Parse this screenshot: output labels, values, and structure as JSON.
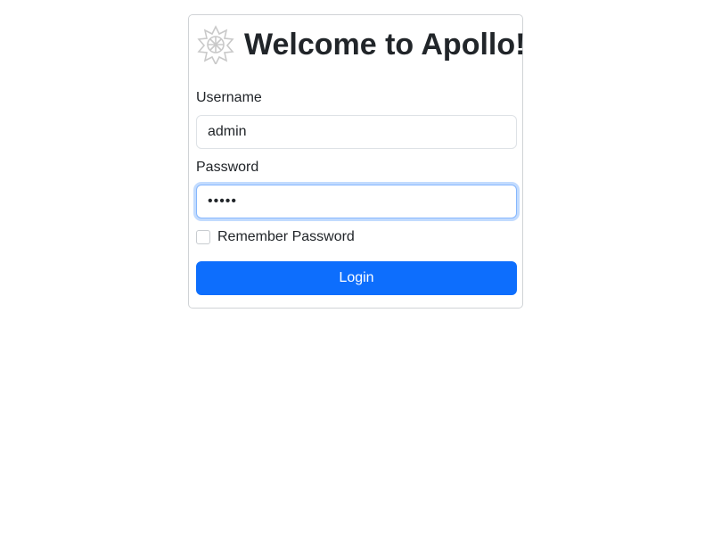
{
  "header": {
    "logo_icon": "apollo-logo-icon",
    "title": "Welcome to Apollo!"
  },
  "form": {
    "username_label": "Username",
    "username_value": "admin",
    "password_label": "Password",
    "password_value": "admin",
    "remember_label": "Remember Password",
    "remember_checked": false,
    "login_label": "Login"
  },
  "colors": {
    "primary": "#0d6efd",
    "focus_border": "#86b7fe",
    "text": "#212529",
    "card_border": "#d0d3d6"
  }
}
